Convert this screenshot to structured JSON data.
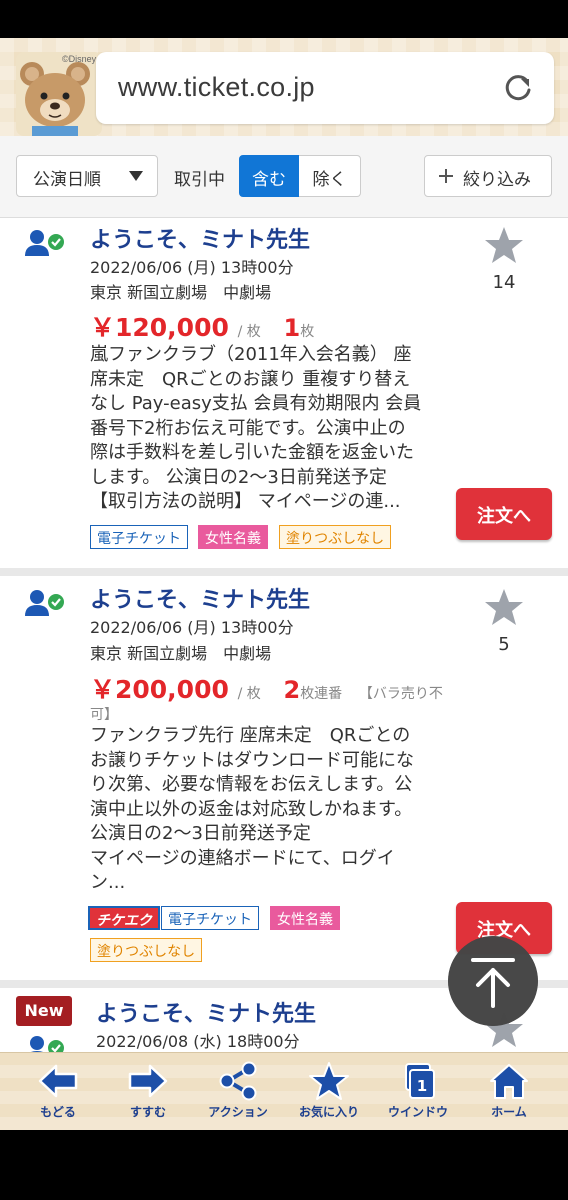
{
  "browser": {
    "url": "www.ticket.co.jp",
    "logo_copyright": "©Disney"
  },
  "filters": {
    "sort_label": "公演日順",
    "deal_label": "取引中",
    "include_label": "含む",
    "exclude_label": "除く",
    "narrow_label": "絞り込み"
  },
  "listings": [
    {
      "title": "ようこそ、ミナト先生",
      "date": "2022/06/06 (月) 13時00分",
      "venue": "東京 新国立劇場　中劇場",
      "price": "￥120,000",
      "per": "/ 枚",
      "qty": "1",
      "qty_unit": "枚",
      "qty_note": "",
      "desc_lines": [
        "嵐ファンクラブ（2011年入会名義） 座",
        "席未定　QRごとのお譲り 重複すり替え",
        "なし Pay-easy支払 会員有効期限内 会員",
        "番号下2桁お伝え可能です。公演中止の",
        "際は手数料を差し引いた金額を返金いた",
        "します。 公演日の2〜3日前発送予定",
        "【取引方法の説明】 マイページの連..."
      ],
      "favorites": "14",
      "order_label": "注文へ",
      "tags": [
        "電子チケット",
        "女性名義",
        "塗りつぶしなし"
      ]
    },
    {
      "title": "ようこそ、ミナト先生",
      "date": "2022/06/06 (月) 13時00分",
      "venue": "東京 新国立劇場　中劇場",
      "price": "￥200,000",
      "per": "/ 枚",
      "qty": "2",
      "qty_unit": "枚連番",
      "qty_note": "【バラ売り不",
      "qty_note_cont": "可】",
      "desc_lines": [
        "ファンクラブ先行 座席未定　QRごとの",
        "お譲りチケットはダウンロード可能にな",
        "り次第、必要な情報をお伝えします。公",
        "演中止以外の返金は対応致しかねます。",
        "公演日の2〜3日前発送予定",
        "マイページの連絡ボードにて、ログイ",
        "ン..."
      ],
      "favorites": "5",
      "order_label": "注文へ",
      "tags": [
        "チケエク",
        "電子チケット",
        "女性名義",
        "塗りつぶしなし"
      ]
    },
    {
      "badge": "New",
      "title": "ようこそ、ミナト先生",
      "date": "2022/06/08 (水) 18時00分"
    }
  ],
  "toolbar": [
    {
      "label": "もどる",
      "icon": "back-arrow-icon"
    },
    {
      "label": "すすむ",
      "icon": "forward-arrow-icon"
    },
    {
      "label": "アクション",
      "icon": "share-icon"
    },
    {
      "label": "お気に入り",
      "icon": "star-icon"
    },
    {
      "label": "ウインドウ",
      "icon": "window-icon"
    },
    {
      "label": "ホーム",
      "icon": "home-icon"
    }
  ],
  "window_count": "1",
  "colors": {
    "title_blue": "#1d3f8f",
    "price_red": "#e3262a",
    "accent_blue": "#1176d6",
    "order_red": "#e0323a"
  }
}
